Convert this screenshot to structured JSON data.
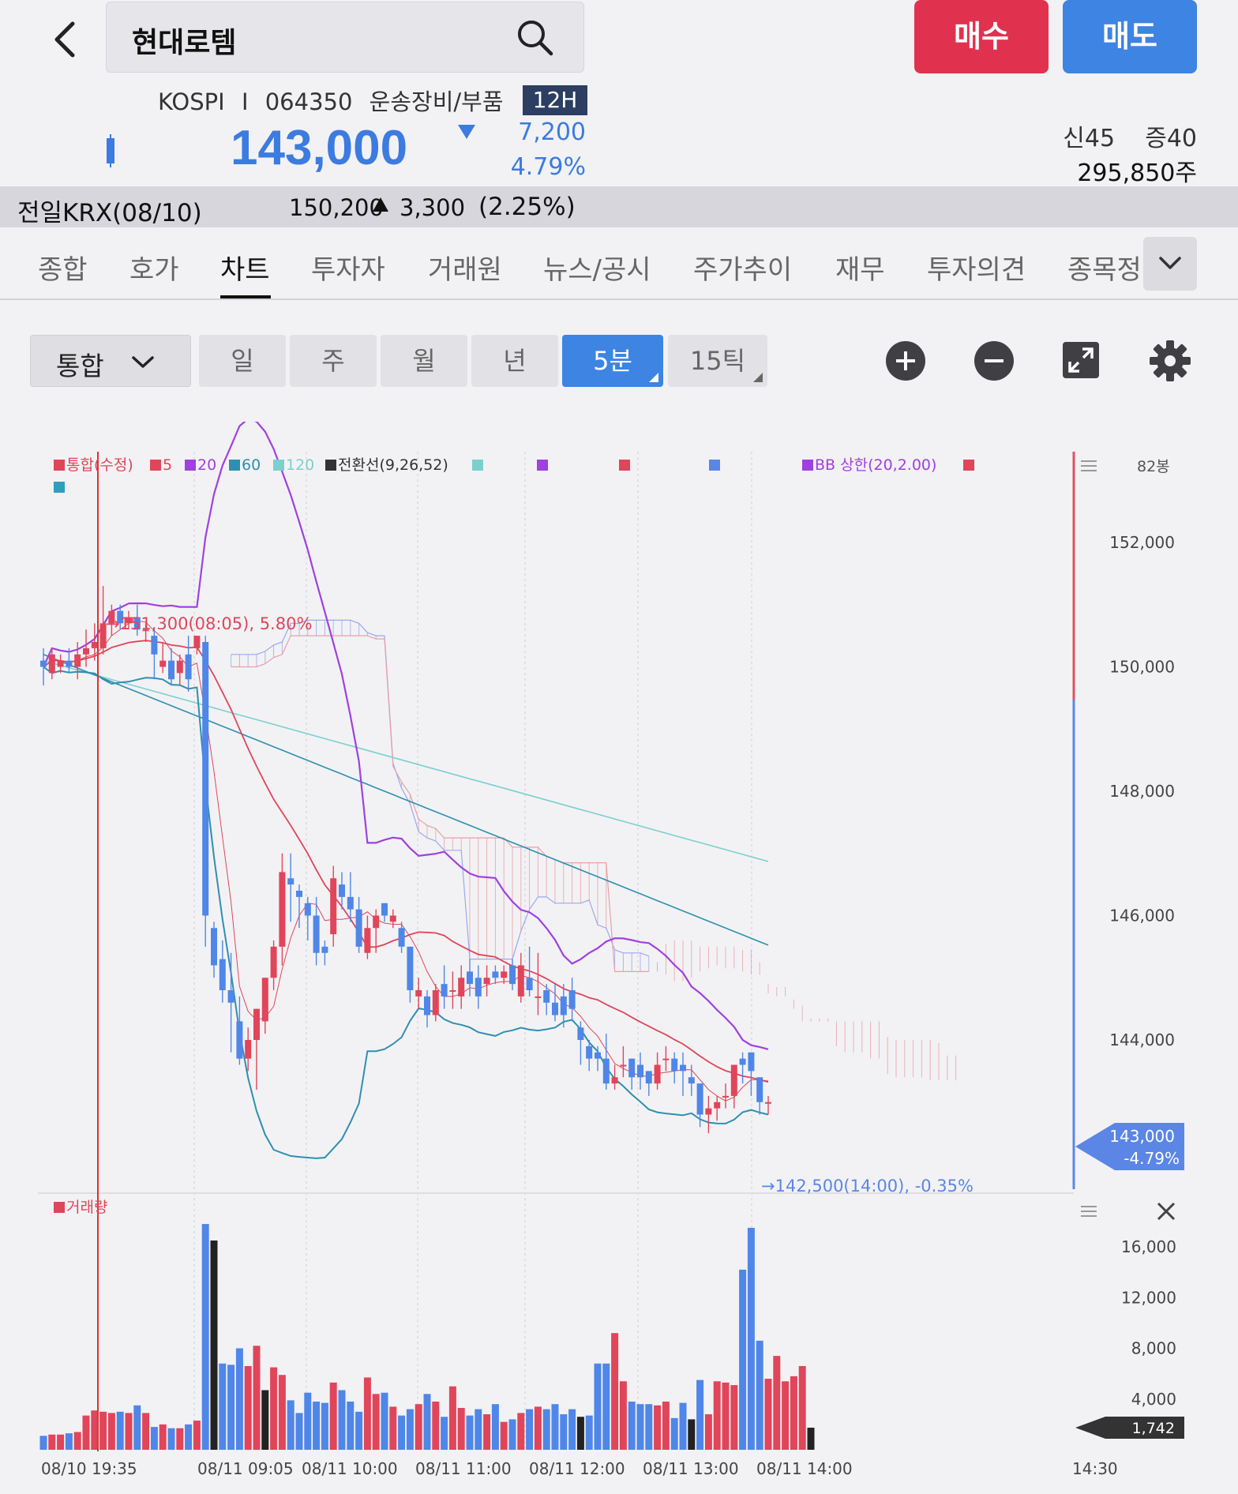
{
  "header": {
    "back_label": "<",
    "search_value": "현대로템",
    "buy_label": "매수",
    "sell_label": "매도"
  },
  "quote": {
    "market": "KOSPI",
    "separator": "I",
    "code": "064350",
    "sector": "운송장비/부품",
    "session_tag": "12H",
    "price": "143,000",
    "change": "7,200",
    "change_pct": "4.79%",
    "credit_text": "신45    증40",
    "volume_text": "295,850주",
    "price_color": "#3c7be0"
  },
  "prev": {
    "label": "전일KRX(08/10)",
    "value": "150,200",
    "change": "3,300",
    "pct": "(2.25%)"
  },
  "tabs": [
    "종합",
    "호가",
    "차트",
    "투자자",
    "거래원",
    "뉴스/공시",
    "주가추이",
    "재무",
    "투자의견",
    "종목정"
  ],
  "active_tab": "차트",
  "toolbar": {
    "chart_type": "통합",
    "periods": [
      "일",
      "주",
      "월",
      "년",
      "5분",
      "15틱"
    ],
    "selected_period": "5분"
  },
  "legend": {
    "main": "통합(수정)",
    "ma5": "5",
    "ma20": "20",
    "ma60": "60",
    "ma120": "120",
    "conv": "전환선(9,26,52)",
    "bb": "BB 상한(20,2.00)",
    "bar_count": "82봉",
    "volume": "거래량"
  },
  "annotations": {
    "high": "→151,300(08:05), 5.80%",
    "low": "→142,500(14:00), -0.35%",
    "current_price": "143,000",
    "current_pct": "-4.79%",
    "current_volume": "1,742"
  },
  "colors": {
    "up": "#e0455a",
    "down": "#4f86e8",
    "ma20": "#a040e0",
    "ma60": "#2f8fb0",
    "ma120": "#7ccfcf",
    "conv": "#333333",
    "cloud_up": "#9aa8ee",
    "cloud_dn": "#e8a0a8"
  },
  "chart_data": {
    "type": "candlestick",
    "price_ticks": [
      "152,000",
      "150,000",
      "148,000",
      "146,000",
      "144,000"
    ],
    "price_tick_values": [
      152000,
      150000,
      148000,
      146000,
      144000
    ],
    "volume_ticks": [
      "16,000",
      "12,000",
      "8,000",
      "4,000"
    ],
    "volume_tick_values": [
      16000,
      12000,
      8000,
      4000
    ],
    "time_labels": [
      "08/10 19:35",
      "08/11 09:05",
      "08/11 10:00",
      "08/11 11:00",
      "08/11 12:00",
      "08/11 13:00",
      "08/11 14:00",
      "14:30"
    ],
    "candles": [
      [
        150100,
        150000,
        149700,
        150300
      ],
      [
        149900,
        150200,
        149800,
        150300
      ],
      [
        150000,
        150100,
        149900,
        150200
      ],
      [
        150100,
        150000,
        149900,
        150300
      ],
      [
        150000,
        150200,
        149800,
        150400
      ],
      [
        150200,
        150300,
        150000,
        150600
      ],
      [
        150300,
        150400,
        150100,
        150700
      ],
      [
        150300,
        150700,
        150200,
        151300
      ],
      [
        150700,
        150900,
        150500,
        151000
      ],
      [
        150900,
        150700,
        150600,
        151000
      ],
      [
        150700,
        150800,
        150600,
        150900
      ],
      [
        150800,
        150600,
        150500,
        151000
      ],
      [
        150600,
        150600,
        150400,
        150700
      ],
      [
        150500,
        150200,
        149800,
        150600
      ],
      [
        150000,
        150100,
        149900,
        150400
      ],
      [
        150100,
        149800,
        149700,
        150300
      ],
      [
        149900,
        150100,
        149700,
        150200
      ],
      [
        150200,
        149800,
        149600,
        150500
      ],
      [
        150300,
        150500,
        150200,
        150500
      ],
      [
        150400,
        146000,
        145500,
        150500
      ],
      [
        145800,
        145200,
        145000,
        145900
      ],
      [
        145300,
        144800,
        144600,
        145600
      ],
      [
        144800,
        144600,
        143800,
        145400
      ],
      [
        144300,
        143700,
        143600,
        144700
      ],
      [
        143700,
        144000,
        143500,
        144200
      ],
      [
        144000,
        144500,
        143200,
        144500
      ],
      [
        144300,
        145000,
        144100,
        145000
      ],
      [
        145000,
        145500,
        144800,
        145600
      ],
      [
        145500,
        146700,
        145200,
        147000
      ],
      [
        146600,
        146500,
        145900,
        147000
      ],
      [
        146400,
        146300,
        145800,
        146500
      ],
      [
        146200,
        146000,
        145600,
        146300
      ],
      [
        146000,
        145400,
        145200,
        146300
      ],
      [
        145500,
        145400,
        145200,
        145600
      ],
      [
        145700,
        146600,
        145500,
        146800
      ],
      [
        146500,
        146300,
        146100,
        146700
      ],
      [
        146300,
        146100,
        145900,
        146700
      ],
      [
        146100,
        145500,
        145400,
        146300
      ],
      [
        145400,
        145800,
        145300,
        146000
      ],
      [
        145800,
        146000,
        145400,
        146100
      ],
      [
        146200,
        146000,
        145900,
        146200
      ],
      [
        145900,
        146000,
        145800,
        146100
      ],
      [
        145800,
        145500,
        145400,
        145900
      ],
      [
        145500,
        144800,
        144600,
        145500
      ],
      [
        144700,
        144800,
        144500,
        145000
      ],
      [
        144700,
        144400,
        144200,
        144800
      ],
      [
        144400,
        144800,
        144300,
        144900
      ],
      [
        144900,
        144700,
        144500,
        145200
      ],
      [
        144800,
        144800,
        144500,
        145100
      ],
      [
        144700,
        145000,
        144500,
        145200
      ],
      [
        145100,
        144900,
        144700,
        145300
      ],
      [
        145000,
        144700,
        144500,
        145200
      ],
      [
        144900,
        145000,
        144700,
        145200
      ],
      [
        145100,
        145000,
        144900,
        145200
      ],
      [
        145000,
        145100,
        144900,
        145200
      ],
      [
        145200,
        144900,
        144800,
        145300
      ],
      [
        144700,
        145200,
        144600,
        145400
      ],
      [
        145000,
        144800,
        144700,
        145500
      ],
      [
        144700,
        144700,
        144400,
        145400
      ],
      [
        144800,
        144600,
        144400,
        144900
      ],
      [
        144600,
        144400,
        144300,
        144900
      ],
      [
        144700,
        144400,
        144200,
        144900
      ],
      [
        144800,
        144500,
        144300,
        145000
      ],
      [
        144200,
        144000,
        143600,
        144300
      ],
      [
        143900,
        143700,
        143500,
        144000
      ],
      [
        143800,
        143700,
        143500,
        143900
      ],
      [
        143700,
        143300,
        143200,
        144100
      ],
      [
        143300,
        143400,
        143200,
        143600
      ],
      [
        143600,
        143600,
        143400,
        143900
      ],
      [
        143700,
        143400,
        143200,
        143700
      ],
      [
        143600,
        143400,
        143200,
        143800
      ],
      [
        143500,
        143300,
        143100,
        143500
      ],
      [
        143300,
        143600,
        143200,
        143800
      ],
      [
        143700,
        143700,
        143500,
        143900
      ],
      [
        143700,
        143500,
        143300,
        143800
      ],
      [
        143600,
        143500,
        143100,
        143800
      ],
      [
        143400,
        143300,
        143100,
        143600
      ],
      [
        143300,
        142800,
        142600,
        143300
      ],
      [
        142800,
        142900,
        142500,
        143100
      ],
      [
        142900,
        143000,
        142700,
        143100
      ],
      [
        143100,
        143100,
        142900,
        143300
      ],
      [
        143100,
        143600,
        142900,
        143600
      ],
      [
        143700,
        143600,
        143300,
        143800
      ],
      [
        143800,
        143500,
        143100,
        143800
      ],
      [
        143400,
        143000,
        142800,
        143400
      ],
      [
        143000,
        143000,
        142800,
        143100
      ]
    ],
    "volumes": [
      1100,
      1200,
      1200,
      1300,
      1400,
      2700,
      3100,
      3000,
      2900,
      3000,
      2900,
      3500,
      2900,
      1800,
      2000,
      1700,
      1700,
      2000,
      2300,
      17800,
      16500,
      6800,
      6700,
      8000,
      6600,
      8200,
      4700,
      6500,
      5900,
      3900,
      2900,
      4500,
      3800,
      3700,
      5300,
      4700,
      3800,
      3000,
      5700,
      4400,
      4500,
      3400,
      2700,
      3200,
      3600,
      4400,
      3800,
      2600,
      5000,
      3300,
      2700,
      3200,
      2800,
      3600,
      2200,
      2400,
      2900,
      3200,
      3400,
      3200,
      3600,
      2800,
      3200,
      2600,
      2700,
      6800,
      6800,
      9200,
      5400,
      3800,
      3600,
      3600,
      3500,
      3800,
      2500,
      3700,
      2400,
      5500,
      2800,
      5400,
      5300,
      5100,
      14200,
      17500,
      8600,
      5600,
      7400,
      5400,
      5800,
      6600,
      1742
    ],
    "price_ylim": [
      142000,
      154800
    ],
    "volume_ylim": [
      0,
      18500
    ]
  }
}
